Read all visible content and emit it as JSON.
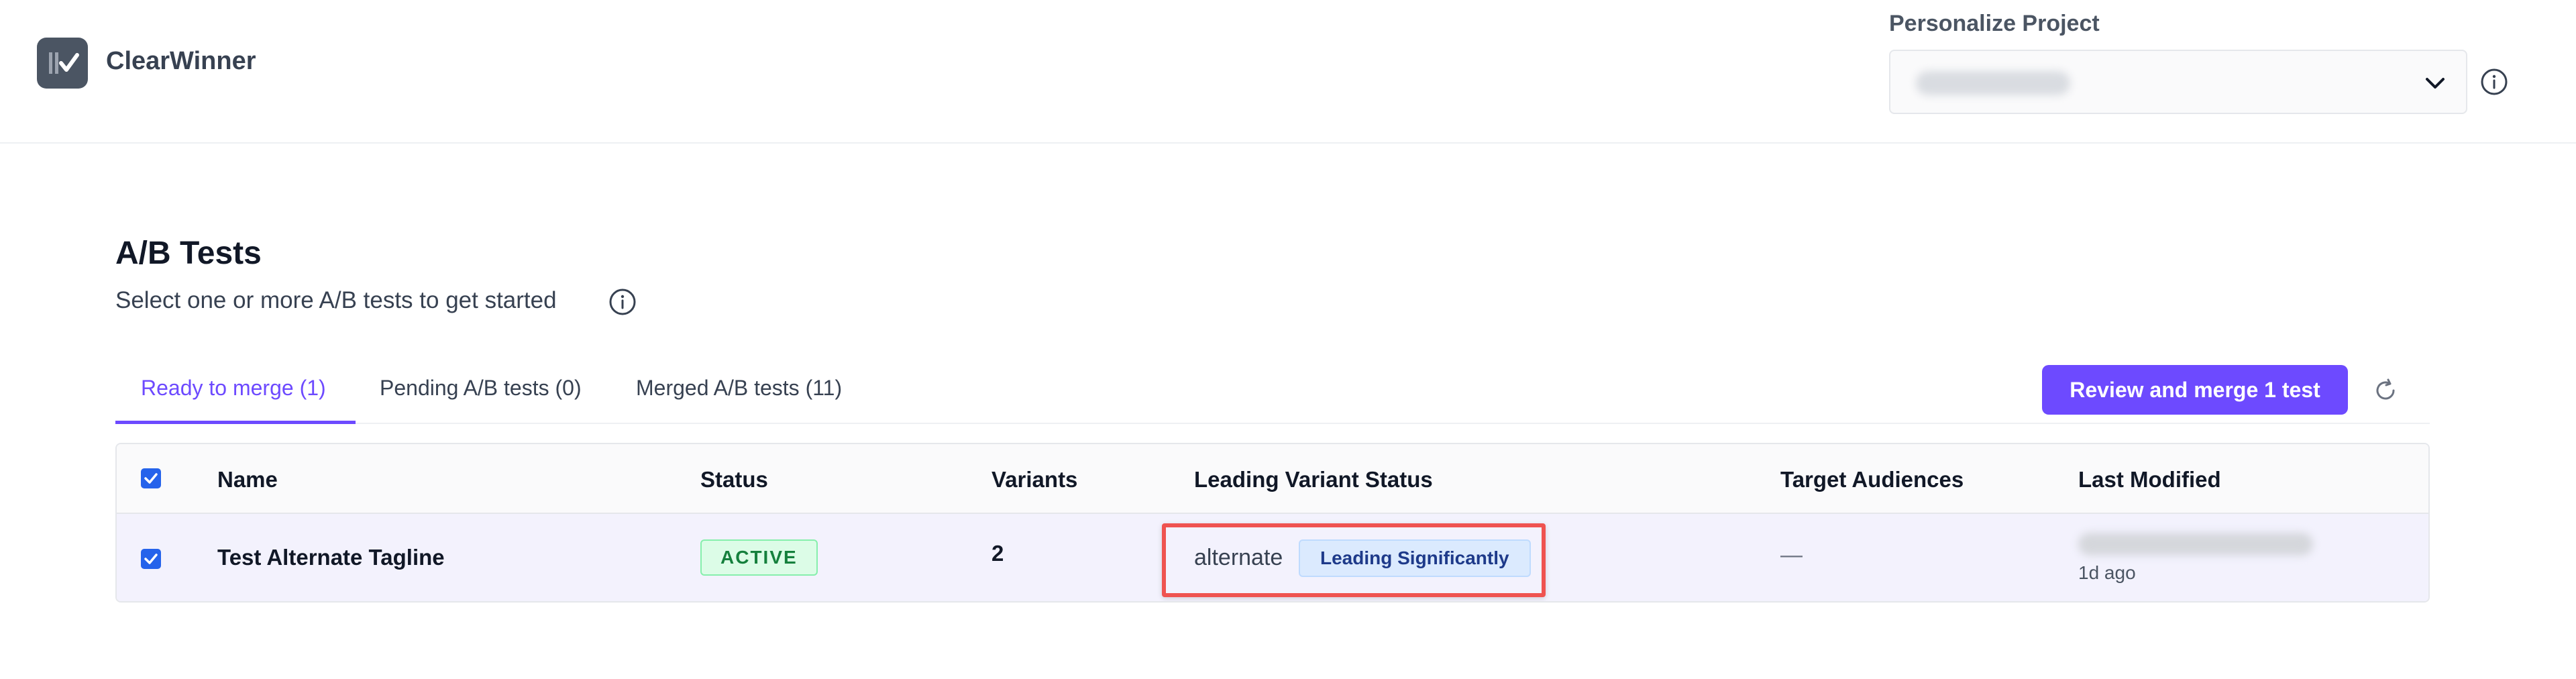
{
  "app": {
    "name": "ClearWinner"
  },
  "project": {
    "label": "Personalize Project"
  },
  "page": {
    "title": "A/B Tests",
    "subtitle": "Select one or more A/B tests to get started"
  },
  "tabs": [
    {
      "label": "Ready to merge (1)",
      "active": true
    },
    {
      "label": "Pending A/B tests (0)",
      "active": false
    },
    {
      "label": "Merged A/B tests (11)",
      "active": false
    }
  ],
  "actions": {
    "merge_label": "Review and merge 1 test"
  },
  "table": {
    "columns": [
      "Name",
      "Status",
      "Variants",
      "Leading Variant Status",
      "Target Audiences",
      "Last Modified"
    ],
    "rows": [
      {
        "name": "Test Alternate Tagline",
        "status": "ACTIVE",
        "variants": "2",
        "leading_variant": "alternate",
        "leading_badge": "Leading Significantly",
        "target_audiences": "—",
        "last_modified": "1d ago"
      }
    ]
  },
  "colors": {
    "accent": "#6d4aff",
    "checkbox": "#2563eb",
    "active_badge": "#15803d",
    "highlight": "#ef5350"
  },
  "icons": [
    "logo-icon",
    "chevron-down-icon",
    "info-icon",
    "refresh-icon",
    "checkbox-checked-icon"
  ]
}
